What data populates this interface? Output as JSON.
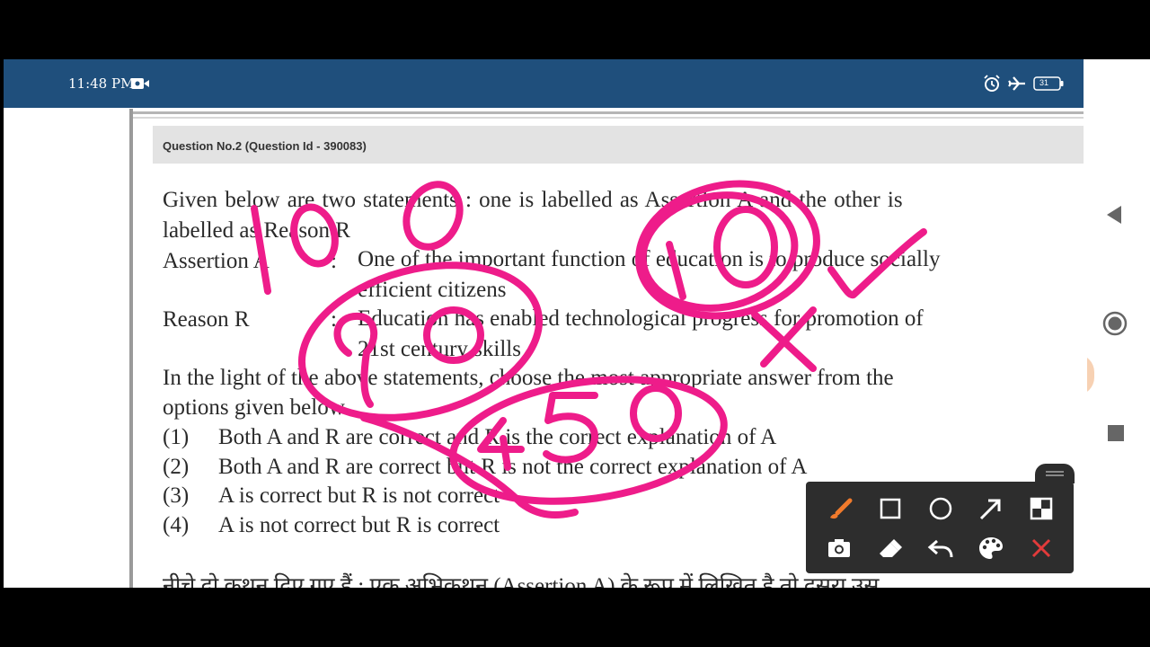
{
  "status": {
    "time": "11:48 PM",
    "battery": "31"
  },
  "question": {
    "header": "Question No.2 (Question Id - 390083)",
    "intro_line1": "Given below are two statements : one is labelled as Assertion A and the other is",
    "intro_line2": "labelled as Reason R",
    "assertion_label": "Assertion A",
    "assertion_text1": "One of the important function of education is to produce socially",
    "assertion_text2": "efficient citizens",
    "reason_label": "Reason R",
    "reason_text1": "Education has enabled technological progress for promotion of",
    "reason_text2": "21st century skills",
    "instruction_line1": "In the light of the above statements, choose the most appropriate answer from the",
    "instruction_line2": "options given below",
    "options": [
      {
        "num": "(1)",
        "text": "Both A and R are correct and R is the correct explanation of A"
      },
      {
        "num": "(2)",
        "text": "Both A and R are correct but R is not the correct explanation of A"
      },
      {
        "num": "(3)",
        "text": "A is correct but R is not correct"
      },
      {
        "num": "(4)",
        "text": "A is not correct but R is correct"
      }
    ],
    "hindi_partial": "नीचे दो कथन दिए गए हैं : एक अभिकथन (Assertion A) के रूप में लिखित है तो दूसरा उस"
  },
  "annotations": {
    "color": "#ee1c8a",
    "scribbles": [
      "100",
      "90",
      "450",
      "10",
      "×",
      "✓"
    ]
  },
  "toolbar": {
    "tools": [
      "pen-tool",
      "rectangle-tool",
      "circle-tool",
      "arrow-tool",
      "blur-tool",
      "screenshot-tool",
      "eraser-tool",
      "undo-tool",
      "color-palette-tool",
      "close-tool"
    ],
    "active_color": "#f07a2c",
    "close_color": "#e23b3b"
  }
}
